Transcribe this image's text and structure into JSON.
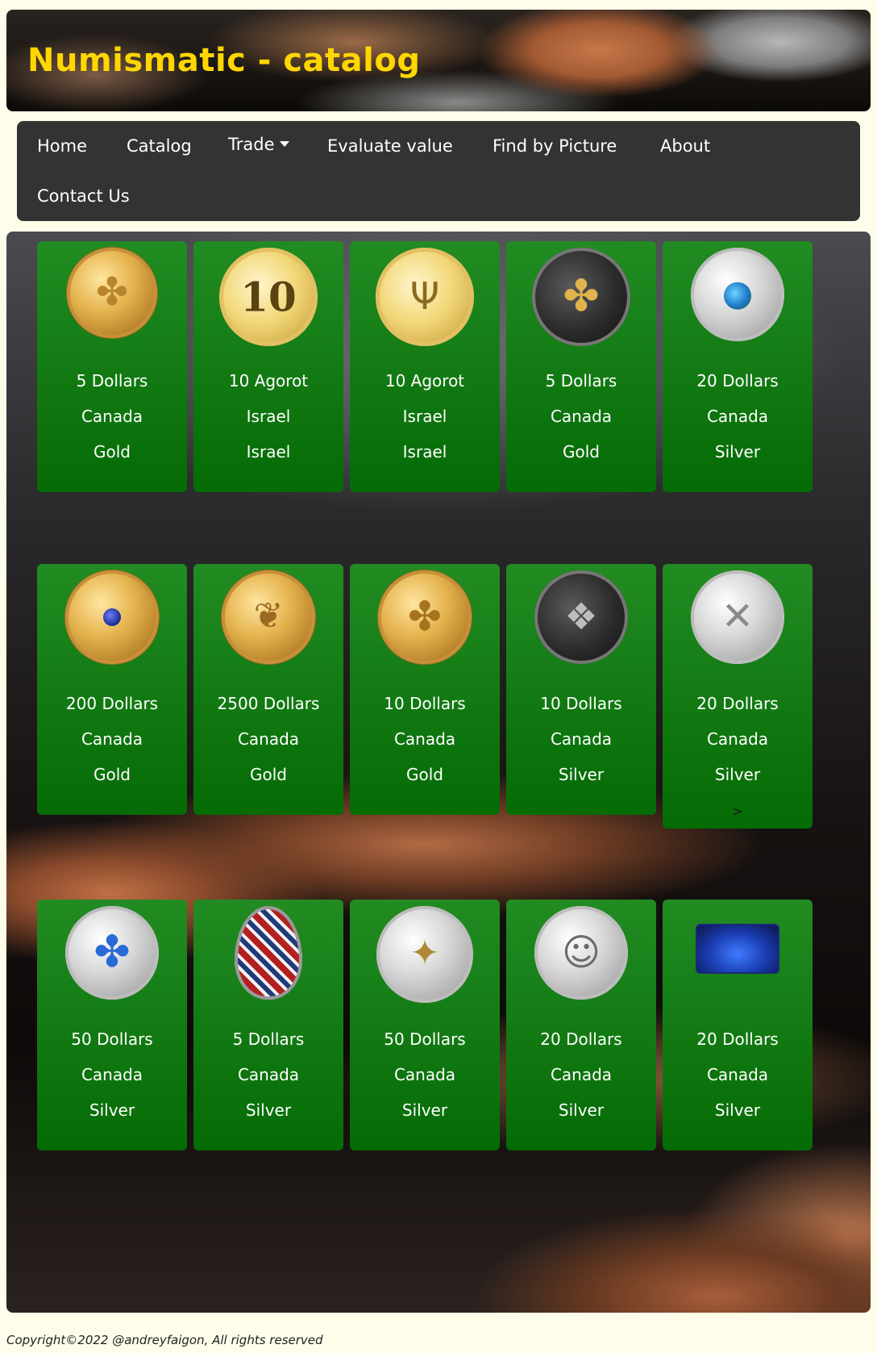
{
  "header": {
    "title": "Numismatic - catalog"
  },
  "nav": {
    "items": [
      {
        "label": "Home"
      },
      {
        "label": "Catalog"
      },
      {
        "label": "Trade"
      },
      {
        "label": "Evaluate value"
      },
      {
        "label": "Find by Picture"
      },
      {
        "label": "About"
      },
      {
        "label": "Contact Us"
      }
    ]
  },
  "catalog": {
    "cards": [
      {
        "value": "5 Dollars",
        "country": "Canada",
        "metal": "Gold",
        "coin_image": "gold-maple-leaf-coin"
      },
      {
        "value": "10 Agorot",
        "country": "Israel",
        "metal": "Israel",
        "coin_image": "israel-10-agorot-coin",
        "coin_text": "10"
      },
      {
        "value": "10 Agorot",
        "country": "Israel",
        "metal": "Israel",
        "coin_image": "israel-menorah-coin"
      },
      {
        "value": "5 Dollars",
        "country": "Canada",
        "metal": "Gold",
        "coin_image": "black-gold-maple-leaf-coin"
      },
      {
        "value": "20 Dollars",
        "country": "Canada",
        "metal": "Silver",
        "coin_image": "silver-earth-coin"
      },
      {
        "value": "200 Dollars",
        "country": "Canada",
        "metal": "Gold",
        "coin_image": "gold-sapphire-coin"
      },
      {
        "value": "2500 Dollars",
        "country": "Canada",
        "metal": "Gold",
        "coin_image": "gold-rabbit-coin"
      },
      {
        "value": "10 Dollars",
        "country": "Canada",
        "metal": "Gold",
        "coin_image": "gold-maple-leaves-coin"
      },
      {
        "value": "10 Dollars",
        "country": "Canada",
        "metal": "Silver",
        "coin_image": "black-silver-dinosaur-coin"
      },
      {
        "value": "20 Dollars",
        "country": "Canada",
        "metal": "Silver",
        "coin_image": "silver-quilt-coin",
        "arrow": ">"
      },
      {
        "value": "50 Dollars",
        "country": "Canada",
        "metal": "Silver",
        "coin_image": "silver-maple-landscape-coin"
      },
      {
        "value": "5 Dollars",
        "country": "Canada",
        "metal": "Silver",
        "coin_image": "pysanka-egg-coin"
      },
      {
        "value": "50 Dollars",
        "country": "Canada",
        "metal": "Silver",
        "coin_image": "silver-compass-coin"
      },
      {
        "value": "20 Dollars",
        "country": "Canada",
        "metal": "Silver",
        "coin_image": "silver-queen-portrait-coin"
      },
      {
        "value": "20 Dollars",
        "country": "Canada",
        "metal": "Silver",
        "coin_image": "blue-rectangular-coin"
      }
    ]
  },
  "footer": {
    "text": "Copyright©2022 @andreyfaigon, All rights reserved"
  },
  "colors": {
    "title": "#ffd700",
    "nav_bg": "#333333",
    "card_green": "#228b22",
    "page_bg": "#fdfdea"
  }
}
